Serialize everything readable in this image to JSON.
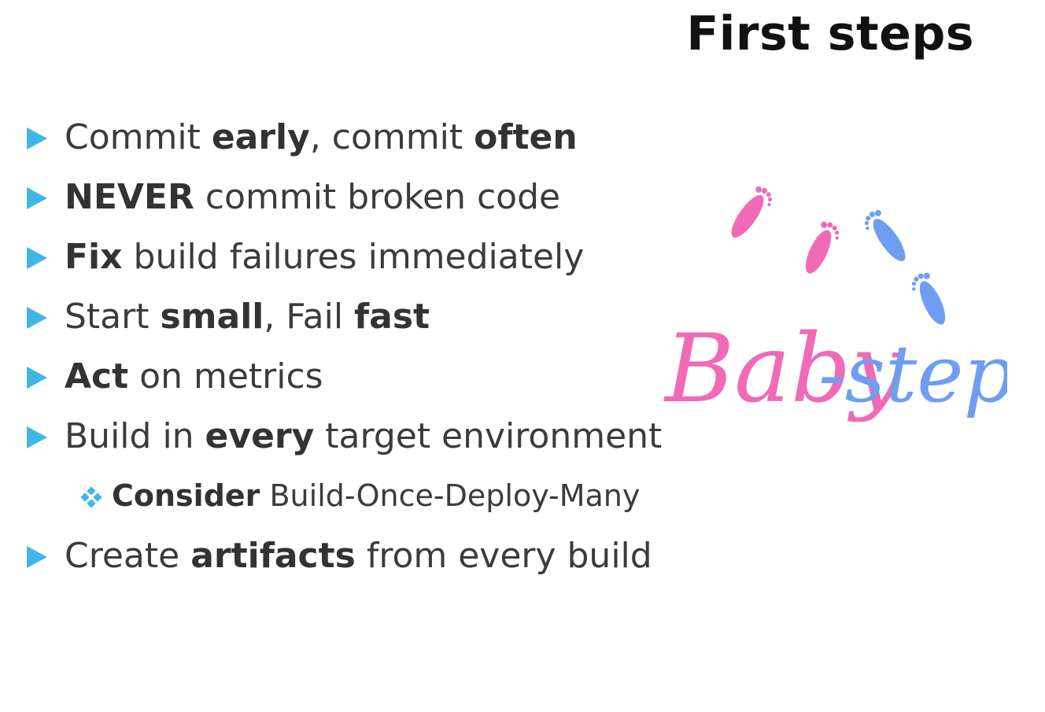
{
  "slide": {
    "title": "First steps",
    "bullets": [
      {
        "level": 1,
        "segments": [
          {
            "text": "Commit ",
            "bold": false
          },
          {
            "text": "early",
            "bold": true
          },
          {
            "text": ", commit ",
            "bold": false
          },
          {
            "text": "often",
            "bold": true
          }
        ]
      },
      {
        "level": 1,
        "segments": [
          {
            "text": "NEVER",
            "bold": true
          },
          {
            "text": " commit broken code",
            "bold": false
          }
        ]
      },
      {
        "level": 1,
        "segments": [
          {
            "text": "Fix",
            "bold": true
          },
          {
            "text": " build failures immediately",
            "bold": false
          }
        ]
      },
      {
        "level": 1,
        "segments": [
          {
            "text": "Start ",
            "bold": false
          },
          {
            "text": "small",
            "bold": true
          },
          {
            "text": ", Fail ",
            "bold": false
          },
          {
            "text": "fast",
            "bold": true
          }
        ]
      },
      {
        "level": 1,
        "segments": [
          {
            "text": "Act",
            "bold": true
          },
          {
            "text": " on metrics",
            "bold": false
          }
        ]
      },
      {
        "level": 1,
        "segments": [
          {
            "text": "Build in ",
            "bold": false
          },
          {
            "text": "every",
            "bold": true
          },
          {
            "text": " target environment",
            "bold": false
          }
        ]
      },
      {
        "level": 2,
        "segments": [
          {
            "text": "Consider",
            "bold": true
          },
          {
            "text": " Build-Once-Deploy-Many",
            "bold": false
          }
        ]
      },
      {
        "level": 1,
        "segments": [
          {
            "text": "Create ",
            "bold": false
          },
          {
            "text": "artifacts",
            "bold": true
          },
          {
            "text": " from every build",
            "bold": false
          }
        ]
      }
    ],
    "logo": {
      "text_left": "Baby",
      "text_right": "-steps",
      "color_left": "#f06ab8",
      "color_right": "#6f9ef0",
      "icon": "baby-footprints-icon"
    },
    "colors": {
      "bullet": "#3fb6e8",
      "text": "#3b3b3b",
      "title": "#111111"
    }
  }
}
